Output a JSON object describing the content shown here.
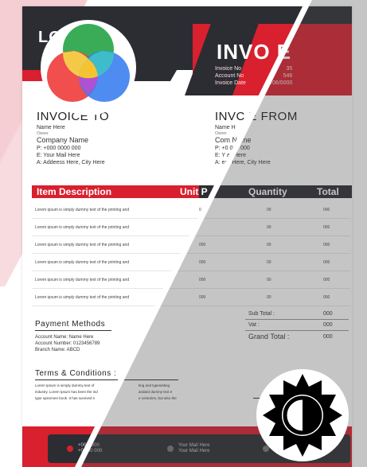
{
  "header": {
    "logo_text": "LO      E",
    "title": "INVO  E",
    "meta_labels": [
      "Invoice No",
      "Account No",
      "Invoice Date"
    ],
    "meta_values": [
      "35",
      "546",
      "/06/0000"
    ]
  },
  "invoice_to": {
    "heading": "INVOICE TO",
    "name": "Name Here",
    "role": "Owner",
    "company": "Company Name",
    "phone": "P: +000 0000 000",
    "email": "E: Your Mail Here",
    "address": "A: Addeess Here, City Here"
  },
  "invoice_from": {
    "heading": "INVC  E FROM",
    "name": "Name H",
    "role": "Owner",
    "company": "Com     Name",
    "phone": "P: +0      000 000",
    "email": "E: Y      ail Here",
    "address": "A:       ess Here, City Here"
  },
  "table": {
    "headers": [
      "Item Description",
      "Unit P",
      "Quantity",
      "Total"
    ],
    "rows": [
      {
        "desc": "Lorem ipsum is simply dummy text of the printing and",
        "price": "0",
        "qty": "00",
        "total": "000"
      },
      {
        "desc": "Lorem ipsum is simply dummy text of the printing and",
        "price": "",
        "qty": "00",
        "total": "000"
      },
      {
        "desc": "Lorem ipsum is simply dummy text of the printing and",
        "price": "000",
        "qty": "00",
        "total": "000"
      },
      {
        "desc": "Lorem ipsum is simply dummy text of the printing and",
        "price": "000",
        "qty": "00",
        "total": "000"
      },
      {
        "desc": "Lorem ipsum is simply dummy text of the printing and",
        "price": "000",
        "qty": "00",
        "total": "000"
      },
      {
        "desc": "Lorem ipsum is simply dummy text of the printing and",
        "price": "000",
        "qty": "00",
        "total": "000"
      }
    ]
  },
  "payment": {
    "heading": "Payment Methods",
    "account_name": "Account Name: Name Here",
    "account_number": "Account Number: 0123456789",
    "branch": "Branch Name: ABCD"
  },
  "totals": {
    "sub_label": "Sub Total :",
    "sub_value": "000",
    "vat_label": "Vat :",
    "vat_value": "000",
    "grand_label": "Grand Total :",
    "grand_value": "000"
  },
  "terms": {
    "heading": "Terms & Conditions :",
    "line1": "Lorem Ipsum is simply dummy text of",
    "line2": "industry. Lorem Ipsum has been the ind",
    "line3": "type specimen book. It has survived n",
    "line1b": "ting and typesetting",
    "line2b": "andard dummy text e",
    "line3b": "e centuries, but also the"
  },
  "signature": "gnatur",
  "footer": {
    "phone1": "+00      0 000",
    "phone2": "+0      000 000",
    "mail1": "Your Mail Here",
    "mail2": "Your Mail Here"
  },
  "colors": {
    "accent": "#d8202f",
    "dark": "#2b2d33"
  },
  "overlay_icons": [
    "color-wheel-icon",
    "contrast-icon"
  ]
}
